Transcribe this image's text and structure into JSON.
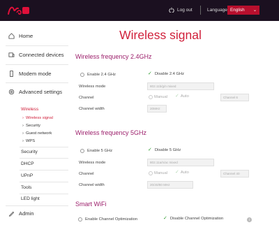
{
  "header": {
    "logo": "virgin-media-logo",
    "logout_label": "Log out",
    "language_label": "Language",
    "language_value": "English"
  },
  "sidebar": {
    "items": [
      {
        "label": "Home",
        "icon": "home-icon"
      },
      {
        "label": "Connected devices",
        "icon": "devices-icon"
      },
      {
        "label": "Modem mode",
        "icon": "modem-icon"
      },
      {
        "label": "Advanced settings",
        "icon": "gear-icon"
      }
    ],
    "advanced": {
      "wireless": "Wireless",
      "wireless_sub": [
        "Wireless signal",
        "Security",
        "Guest network",
        "WPS"
      ],
      "others": [
        "Security",
        "DHCP",
        "UPnP",
        "Tools",
        "LED light"
      ]
    },
    "admin": {
      "label": "Admin",
      "icon": "pencil-icon"
    }
  },
  "main": {
    "title": "Wireless signal",
    "band24": {
      "title": "Wireless frequency 2.4GHz",
      "enable_label": "Enable 2.4 GHz",
      "disable_label": "Disable 2.4 GHz",
      "mode_label": "Wireless mode",
      "mode_value": "802.11b/g/n mixed",
      "channel_label": "Channel",
      "manual_label": "Manual",
      "auto_label": "Auto",
      "channel_value": "Channel 6",
      "width_label": "Channel width",
      "width_value": "20MHz"
    },
    "band5": {
      "title": "Wireless frequency 5GHz",
      "enable_label": "Enable 5 GHz",
      "disable_label": "Disable 5 GHz",
      "mode_label": "Wireless mode",
      "mode_value": "802.11a/n/ac mixed",
      "channel_label": "Channel",
      "manual_label": "Manual",
      "auto_label": "Auto",
      "channel_value": "Channel 40",
      "width_label": "Channel width",
      "width_value": "20/40/80 MHz"
    },
    "smart": {
      "title": "Smart WiFi",
      "enable_label": "Enable Channel Optimization",
      "disable_label": "Disable Channel Optimization"
    }
  },
  "colors": {
    "header_bg": "#1b1020",
    "accent": "#d01f3a",
    "section_title": "#9c1f6b",
    "check": "#2a9a2a"
  }
}
